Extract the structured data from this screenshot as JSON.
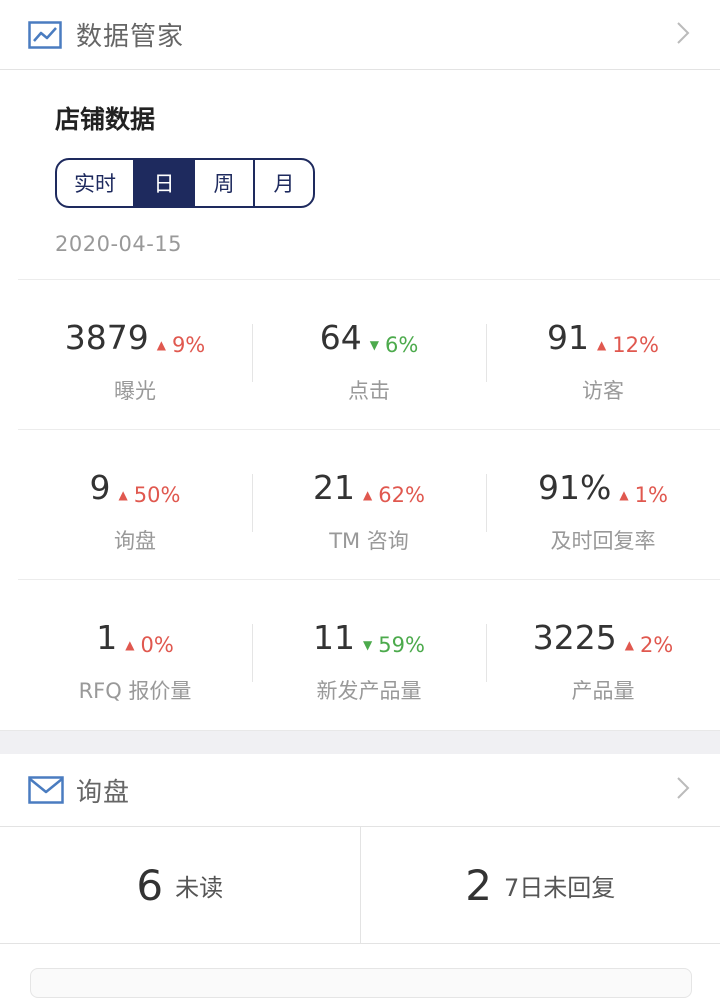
{
  "data_manager": {
    "title": "数据管家",
    "icon": "trend-chart-icon"
  },
  "store": {
    "title": "店铺数据",
    "tabs": [
      {
        "label": "实时",
        "active": false
      },
      {
        "label": "日",
        "active": true
      },
      {
        "label": "周",
        "active": false
      },
      {
        "label": "月",
        "active": false
      }
    ],
    "date": "2020-04-15"
  },
  "metrics": [
    [
      {
        "value": "3879",
        "change": "9%",
        "dir": "up",
        "label": "曝光"
      },
      {
        "value": "64",
        "change": "6%",
        "dir": "down",
        "label": "点击"
      },
      {
        "value": "91",
        "change": "12%",
        "dir": "up",
        "label": "访客"
      }
    ],
    [
      {
        "value": "9",
        "change": "50%",
        "dir": "up",
        "label": "询盘"
      },
      {
        "value": "21",
        "change": "62%",
        "dir": "up",
        "label": "TM 咨询"
      },
      {
        "value": "91%",
        "change": "1%",
        "dir": "up",
        "label": "及时回复率"
      }
    ],
    [
      {
        "value": "1",
        "change": "0%",
        "dir": "up",
        "label": "RFQ 报价量"
      },
      {
        "value": "11",
        "change": "59%",
        "dir": "down",
        "label": "新发产品量"
      },
      {
        "value": "3225",
        "change": "2%",
        "dir": "up",
        "label": "产品量"
      }
    ]
  ],
  "inquiry": {
    "title": "询盘",
    "icon": "mail-icon",
    "unread": {
      "count": "6",
      "label": "未读"
    },
    "unreplied": {
      "count": "2",
      "label": "7日未回复"
    }
  },
  "colors": {
    "accent": "#1e2a5e",
    "up": "#e0584f",
    "down": "#4caa4c",
    "icon_blue": "#4a7cc0"
  }
}
